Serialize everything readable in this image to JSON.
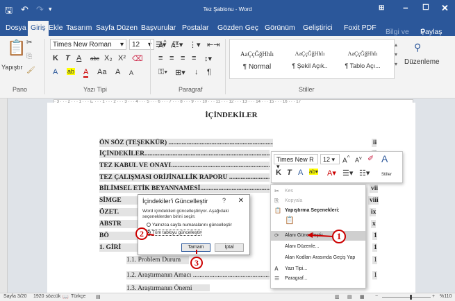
{
  "titlebar": {
    "title": "Tez Şablonu - Word",
    "save_icon": "save-icon",
    "undo_icon": "undo-icon",
    "redo_icon": "redo-icon",
    "customize_icon": "customize-icon"
  },
  "tabs": [
    "Dosya",
    "Giriş",
    "Ekle",
    "Tasarım",
    "Sayfa Düzen",
    "Başvurular",
    "Postalar",
    "Gözden Geç",
    "Görünüm",
    "Geliştirici",
    "Foxit PDF",
    "Bilgi ve",
    "Paylaş"
  ],
  "ribbon": {
    "paste": "Yapıştır",
    "font_name": "Times New Roman",
    "font_size": "12",
    "format_buttons": [
      "K",
      "T",
      "A",
      "abc",
      "X₂",
      "X²"
    ],
    "font_buttons2": [
      "A",
      "ab",
      "A",
      "Aa",
      "A",
      "A"
    ],
    "groups": [
      "Pano",
      "Yazı Tipi",
      "Paragraf",
      "Stiller"
    ],
    "styles": [
      {
        "preview": "AaÇçĞğHhIı",
        "name": "¶ Normal"
      },
      {
        "preview": "AaÇçĞğHhIı",
        "name": "¶ Şekil Açık.."
      },
      {
        "preview": "AaÇçĞğHhIı",
        "name": "¶ Tablo Açı..."
      }
    ],
    "editing": "Düzenleme"
  },
  "document": {
    "heading": "İÇİNDEKİLER",
    "lines": [
      {
        "text": "ÖN SÖZ (TEŞEKKÜR) ................................................................................................",
        "page": "ii"
      },
      {
        "text": "İÇİNDEKİLER.......................................................................................................",
        "page": "ii"
      },
      {
        "text": "TEZ KABUL VE ONAYI........................................................................................",
        "page": ""
      },
      {
        "text": "TEZ ÇALIŞMASI ORİJİNALLİK RAPORU ...........................................................",
        "page": ""
      },
      {
        "text": "BİLİMSEL ETİK BEYANNAMESİ.........................................................................",
        "page": "vii"
      },
      {
        "text": "SİMGE",
        "page": "viii"
      },
      {
        "text": "ÖZET.",
        "page": "ix"
      },
      {
        "text": "ABSTR",
        "page": "x"
      },
      {
        "text": "BÖ",
        "page": "1"
      },
      {
        "text": "1. GİRİ",
        "page": "1"
      }
    ],
    "sub_lines": [
      {
        "text": "1.1. Problem Durum",
        "page": "1"
      },
      {
        "text": "1.2. Araştırmanın Amacı ..................................................................",
        "page": "1"
      },
      {
        "text": "1.3. Araştırmanın Önemi",
        "page": ""
      }
    ]
  },
  "dialog": {
    "title": "İçindekiler'i Güncelleştir",
    "help": "?",
    "close": "✕",
    "message": "Word içindekileri güncelleştiriyor. Aşağıdaki seçeneklerden birini seçin:",
    "option1": "Yalnızca sayfa numaralarını güncelleştir",
    "option2": "Tüm tabloyu güncelleştir",
    "ok": "Tamam",
    "cancel": "İptal"
  },
  "mini_toolbar": {
    "font": "Times New R",
    "size": "12",
    "styles_label": "Stiller"
  },
  "context_menu": {
    "cut": "Kes",
    "copy": "Kopyala",
    "paste_header": "Yapıştırma Seçenekleri:",
    "update_field": "Alanı Güncelleştir",
    "edit_field": "Alanı Düzenle...",
    "toggle_codes": "Alan Kodları Arasında Geçiş Yap",
    "font": "Yazı Tipi...",
    "paragraph": "Paragraf..."
  },
  "callouts": [
    "1",
    "2",
    "3"
  ],
  "status": {
    "page": "Sayfa 3/20",
    "words": "1920 sözcük",
    "lang": "Türkçe",
    "zoom": "%110"
  }
}
